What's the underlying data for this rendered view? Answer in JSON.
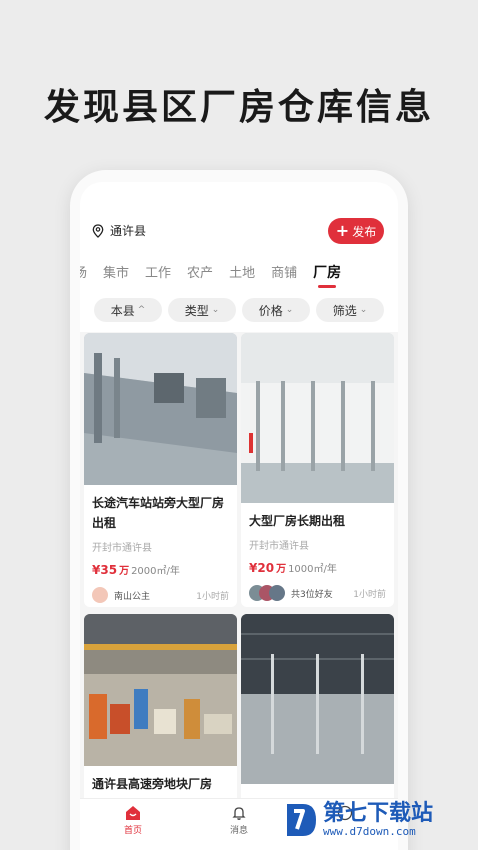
{
  "headline": "发现县区厂房仓库信息",
  "header": {
    "location": "通许县",
    "publish_label": "发布",
    "publish_icon": "plus-icon"
  },
  "tabs": [
    {
      "label": "场",
      "active": false
    },
    {
      "label": "集市",
      "active": false
    },
    {
      "label": "工作",
      "active": false
    },
    {
      "label": "农产",
      "active": false
    },
    {
      "label": "土地",
      "active": false
    },
    {
      "label": "商铺",
      "active": false
    },
    {
      "label": "厂房",
      "active": true
    }
  ],
  "filters": [
    {
      "label": "本县",
      "chevron": "^"
    },
    {
      "label": "类型",
      "chevron": "⌄"
    },
    {
      "label": "价格",
      "chevron": "⌄"
    },
    {
      "label": "筛选",
      "chevron": "⌄"
    }
  ],
  "listings": [
    {
      "title": "长途汽车站站旁大型厂房出租",
      "location": "开封市通许县",
      "price": "¥35",
      "price_unit": "万",
      "area": "2000㎡/年",
      "poster": "南山公主",
      "time": "1小时前"
    },
    {
      "title": "大型厂房长期出租",
      "location": "开封市通许县",
      "price": "¥20",
      "price_unit": "万",
      "area": "1000㎡/年",
      "poster": "共3位好友",
      "time": "1小时前"
    },
    {
      "title": "通许县高速旁地块厂房"
    },
    {
      "title": ""
    }
  ],
  "bottom_nav": [
    {
      "label": "首页",
      "icon": "home-icon",
      "active": true
    },
    {
      "label": "消息",
      "icon": "bell-icon",
      "active": false
    },
    {
      "label": "",
      "icon": "profile-icon",
      "active": false
    }
  ],
  "watermark": {
    "text": "第七下载站",
    "sub": "www.d7down.com"
  },
  "colors": {
    "accent": "#e0303b",
    "watermark": "#1e5bb8"
  }
}
